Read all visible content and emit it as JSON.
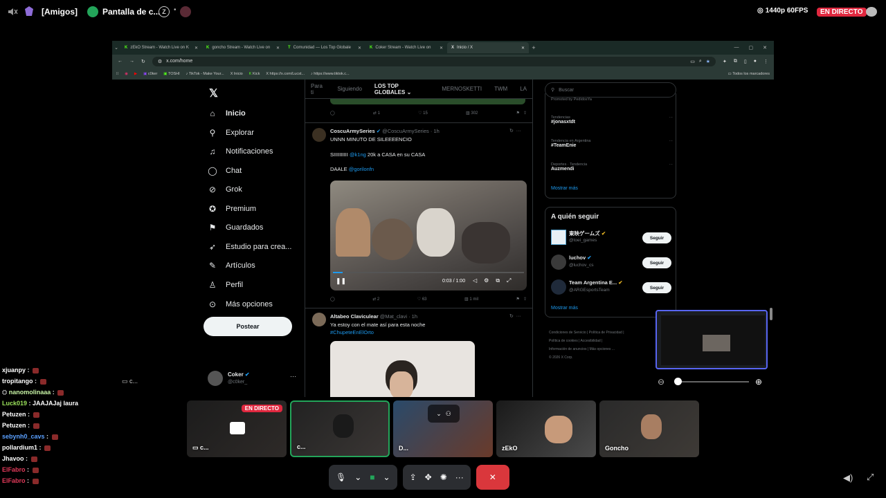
{
  "overlay": {
    "server": "[Amigos]",
    "channel": "Pantalla de c...",
    "quality": "1440p 60FPS",
    "live_badge": "EN DIRECTO"
  },
  "browser": {
    "tabs": [
      {
        "label": "zEkO Stream - Watch Live on K"
      },
      {
        "label": "goncho Stream - Watch Live on"
      },
      {
        "label": "Comunidad — Los Top Globale"
      },
      {
        "label": "Coker Stream - Watch Live on"
      },
      {
        "label": "Inicio / X",
        "active": true
      }
    ],
    "url": "x.com/home",
    "bookmarks": [
      "c0ker",
      "TOSHI",
      "TikTok - Make Your...",
      "Inicio",
      "Kick",
      "https://x.com/Lucst...",
      "https://www.tiktok.c..."
    ],
    "bookmarks_folder": "Todos los marcadores"
  },
  "x": {
    "nav": [
      {
        "label": "Inicio",
        "icon": "home-icon"
      },
      {
        "label": "Explorar",
        "icon": "search-icon"
      },
      {
        "label": "Notificaciones",
        "icon": "bell-icon"
      },
      {
        "label": "Chat",
        "icon": "chat-icon"
      },
      {
        "label": "Grok",
        "icon": "grok-icon"
      },
      {
        "label": "Premium",
        "icon": "verified-icon"
      },
      {
        "label": "Guardados",
        "icon": "bookmark-icon"
      },
      {
        "label": "Estudio para crea...",
        "icon": "rocket-icon"
      },
      {
        "label": "Artículos",
        "icon": "article-icon"
      },
      {
        "label": "Perfil",
        "icon": "person-icon"
      },
      {
        "label": "Más opciones",
        "icon": "more-icon"
      }
    ],
    "post_button": "Postear",
    "account": {
      "name": "Coker",
      "handle": "@c0ker_"
    },
    "timeline_tabs": [
      "Para ti",
      "Siguiendo",
      "LOS TOP GLOBALES",
      "MERNOSKETTI",
      "TWM",
      "LA"
    ],
    "top_actions": {
      "retweets": "1",
      "likes": "15",
      "views": "302"
    },
    "tweet1": {
      "name": "CoscuArmySeries",
      "handle": "@CoscuArmySeries · 1h",
      "line1": "UNNN MINUTO DE SILEEEENCIO",
      "line2_prefix": "SIIIIIIIIII",
      "mention1": "@k1ng",
      "line2_suffix": "20k a CASA en su CASA",
      "line3_prefix": "DAALE",
      "mention2": "@gorilonfn",
      "video_time": "0:03 / 1:00",
      "retweets": "2",
      "likes": "63",
      "views": "1 mil"
    },
    "tweet2": {
      "name": "Altabeo Claviculear",
      "handle": "@Mat_clavi · 1h",
      "text": "Ya estoy con el mate así para esta noche",
      "hashtag": "#ChupeteEnElOrto"
    },
    "search_placeholder": "Buscar",
    "promoted": "Promoted by PedidosYa",
    "trends": [
      {
        "context": "Tendencias",
        "name": "#jonasxtdt"
      },
      {
        "context": "Tendencia en Argentina",
        "name": "#TeamEnie"
      },
      {
        "context": "Deportes · Tendencia",
        "name": "Auzmendi"
      }
    ],
    "show_more": "Mostrar más",
    "who_to_follow_title": "A quién seguir",
    "follow_suggestions": [
      {
        "name": "東映ゲームズ",
        "handle": "@toei_games"
      },
      {
        "name": "luchov",
        "handle": "@luchov_cs"
      },
      {
        "name": "Team Argentina E...",
        "handle": "@ARGEsportsTeam"
      }
    ],
    "follow_label": "Seguir",
    "show_more2": "Mostrar más",
    "footer": [
      "Condiciones de Servicio",
      "Política de Privacidad",
      "Política de cookies",
      "Accesibilidad",
      "Información de anuncios",
      "Más opciones ...",
      "© 2026 X Corp."
    ]
  },
  "chat": [
    {
      "user": "xjuanpy",
      "msg": "",
      "color": "#ffffff"
    },
    {
      "user": "tropitango",
      "msg": "",
      "color": "#ffffff"
    },
    {
      "user": "nanomolinaaa",
      "msg": "",
      "color": "#c7f3a4"
    },
    {
      "user": "Luck019",
      "msg": "JAAJAJaj laura",
      "color": "#9be35b"
    },
    {
      "user": "Petuzen",
      "msg": "",
      "color": "#ffffff"
    },
    {
      "user": "Petuzen",
      "msg": "",
      "color": "#ffffff"
    },
    {
      "user": "sebynh0_cavs",
      "msg": "",
      "color": "#5aa0ff"
    },
    {
      "user": "pollardium1",
      "msg": "",
      "color": "#ffffff"
    },
    {
      "user": "Jhavoo",
      "msg": "",
      "color": "#ffffff"
    },
    {
      "user": "ElFabro",
      "msg": "",
      "color": "#e23a5a"
    },
    {
      "user": "ElFabro",
      "msg": "",
      "color": "#e23a5a"
    }
  ],
  "side_label": "c...",
  "tiles": [
    {
      "label": "c...",
      "live": "EN DIRECTO"
    },
    {
      "label": "c..."
    },
    {
      "label": "D..."
    },
    {
      "label": "zEkO"
    },
    {
      "label": "Goncho"
    }
  ]
}
